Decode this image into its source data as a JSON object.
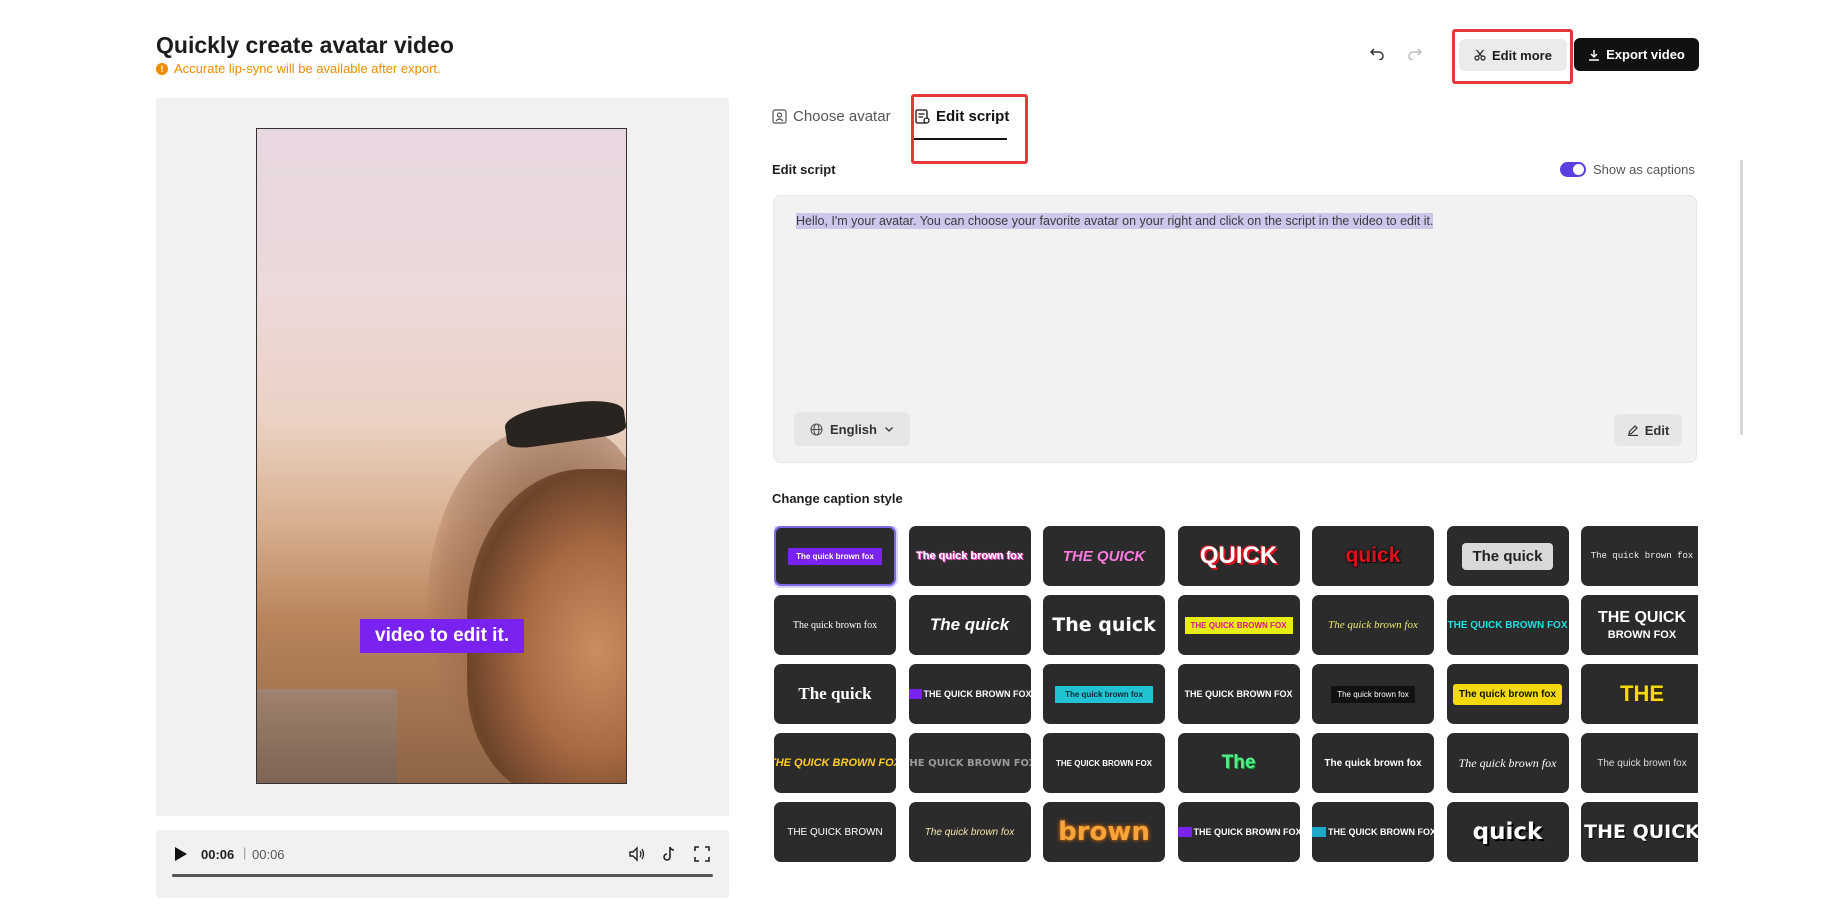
{
  "header": {
    "title": "Quickly create avatar video",
    "notice": "Accurate lip-sync will be available after export.",
    "edit_more_label": "Edit more",
    "export_label": "Export video"
  },
  "preview": {
    "caption": "video to edit it.",
    "time_current": "00:06",
    "time_total": "00:06"
  },
  "tabs": [
    {
      "label": "Choose avatar"
    },
    {
      "label": "Edit script"
    }
  ],
  "script": {
    "heading": "Edit script",
    "show_captions_label": "Show as captions",
    "show_captions_on": true,
    "text": "Hello, I'm your avatar. You can choose your favorite avatar on your right and click on the script in the video to edit it.",
    "language": "English",
    "edit_label": "Edit"
  },
  "caption_style": {
    "heading": "Change caption style",
    "styles": [
      {
        "text": "The quick brown fox"
      },
      {
        "text": "The quick brown fox"
      },
      {
        "text": "THE QUICK"
      },
      {
        "text": "QUICK"
      },
      {
        "text": "quick"
      },
      {
        "text": "The quick"
      },
      {
        "text": "The quick brown fox"
      },
      {
        "text": "The quick brown fox"
      },
      {
        "text": "The quick"
      },
      {
        "text": "The quick"
      },
      {
        "text": "THE QUICK BROWN FOX"
      },
      {
        "text": "The quick brown fox"
      },
      {
        "text": "THE QUICK BROWN FOX"
      },
      {
        "text": "THE QUICK",
        "sub": "BROWN FOX"
      },
      {
        "text": "The quick"
      },
      {
        "text": "THE QUICK BROWN FOX"
      },
      {
        "text": "The quick brown fox"
      },
      {
        "text": "THE QUICK BROWN FOX"
      },
      {
        "text": "The quick brown fox"
      },
      {
        "text": "The quick brown fox"
      },
      {
        "text": "THE"
      },
      {
        "text": "THE QUICK BROWN FOX"
      },
      {
        "text": "THE QUICK BROWN FOX"
      },
      {
        "text": "THE QUICK BROWN FOX"
      },
      {
        "text": "The"
      },
      {
        "text": "The quick brown fox"
      },
      {
        "text": "The quick brown fox"
      },
      {
        "text": "The quick brown fox"
      },
      {
        "text": "THE QUICK BROWN"
      },
      {
        "text": "The quick brown fox"
      },
      {
        "text": "brown"
      },
      {
        "text": "THE QUICK BROWN FOX"
      },
      {
        "text": "THE QUICK BROWN FOX"
      },
      {
        "text": "quick"
      },
      {
        "text": "THE QUICK"
      }
    ]
  }
}
